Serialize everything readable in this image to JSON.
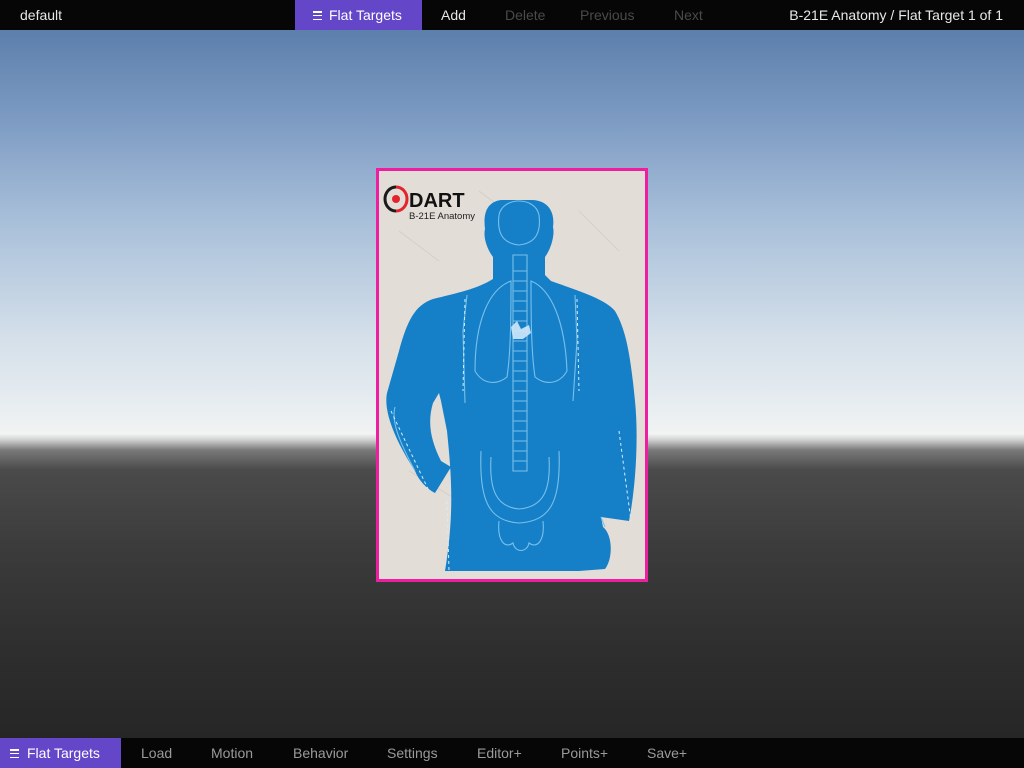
{
  "top_bar": {
    "profile_name": "default",
    "menu_label": "Flat Targets",
    "add_label": "Add",
    "delete_label": "Delete",
    "previous_label": "Previous",
    "next_label": "Next",
    "breadcrumb": "B-21E Anatomy / Flat Target 1 of 1"
  },
  "target": {
    "brand": "DART",
    "model": "B-21E Anatomy",
    "highlight_color": "#ee1ea0",
    "silhouette_color": "#1580c8"
  },
  "bottom_bar": {
    "menu_label": "Flat Targets",
    "items": [
      "Load",
      "Motion",
      "Behavior",
      "Settings",
      "Editor+",
      "Points+",
      "Save+"
    ]
  },
  "colors": {
    "accent": "#6446c8",
    "bar_background": "#060606",
    "disabled_text": "#4a4a4a"
  },
  "icons": {
    "menu": "hamburger-icon"
  }
}
